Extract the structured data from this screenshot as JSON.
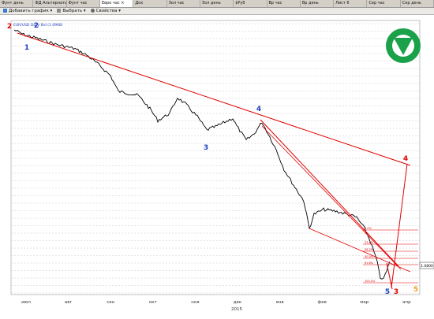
{
  "tabs": [
    "Фунт день",
    "ФД Альтернатива",
    "Фунт час",
    "Евро час",
    "Дох",
    "Зол час",
    "Зол день",
    "$Руб",
    "Вр час",
    "Вр день",
    "Лист 6",
    "Сер час",
    "Сер день"
  ],
  "active_tab": 3,
  "close_glyph": "×",
  "toolbar": {
    "add_chart": "Добавить график",
    "select": "Выбрать",
    "properties": "Свойства"
  },
  "chart_data": {
    "type": "line",
    "legend": "EUR/USD Daily Bid (1.0968)",
    "price_label": "1.0800",
    "x_ticks": [
      "июл",
      "авг",
      "сен",
      "окт",
      "ноя",
      "дек",
      "янв",
      "фев",
      "мар",
      "апр"
    ],
    "year_label": "2015",
    "wave_labels": [
      {
        "text": "2",
        "color": "red"
      },
      {
        "text": "2",
        "color": "blue"
      },
      {
        "text": "1",
        "color": "blue"
      },
      {
        "text": "3",
        "color": "blue"
      },
      {
        "text": "4",
        "color": "blue"
      },
      {
        "text": "5",
        "color": "blue"
      },
      {
        "text": "3",
        "color": "red"
      },
      {
        "text": "4",
        "color": "red"
      },
      {
        "text": "5",
        "color": "orange"
      }
    ],
    "level_labels": [
      "0.0%",
      "23.6%",
      "38.2%",
      "50.0%",
      "61.8%",
      "100.0%"
    ],
    "colors": {
      "trend": "#e00000",
      "price": "#000000",
      "grid": "#c8c8c8",
      "logo": "#1aa14a"
    }
  }
}
